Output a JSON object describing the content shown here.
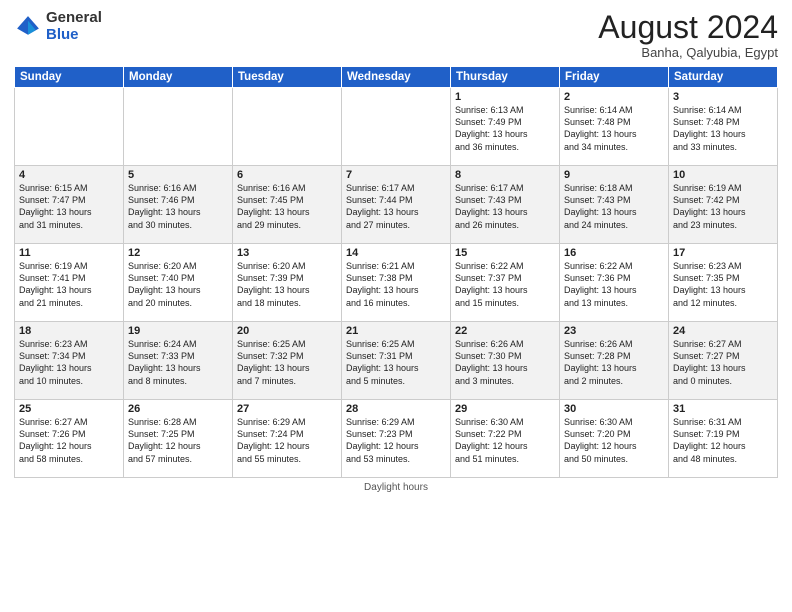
{
  "header": {
    "logo_general": "General",
    "logo_blue": "Blue",
    "month_year": "August 2024",
    "location": "Banha, Qalyubia, Egypt"
  },
  "days_of_week": [
    "Sunday",
    "Monday",
    "Tuesday",
    "Wednesday",
    "Thursday",
    "Friday",
    "Saturday"
  ],
  "weeks": [
    [
      {
        "day": "",
        "info": ""
      },
      {
        "day": "",
        "info": ""
      },
      {
        "day": "",
        "info": ""
      },
      {
        "day": "",
        "info": ""
      },
      {
        "day": "1",
        "info": "Sunrise: 6:13 AM\nSunset: 7:49 PM\nDaylight: 13 hours\nand 36 minutes."
      },
      {
        "day": "2",
        "info": "Sunrise: 6:14 AM\nSunset: 7:48 PM\nDaylight: 13 hours\nand 34 minutes."
      },
      {
        "day": "3",
        "info": "Sunrise: 6:14 AM\nSunset: 7:48 PM\nDaylight: 13 hours\nand 33 minutes."
      }
    ],
    [
      {
        "day": "4",
        "info": "Sunrise: 6:15 AM\nSunset: 7:47 PM\nDaylight: 13 hours\nand 31 minutes."
      },
      {
        "day": "5",
        "info": "Sunrise: 6:16 AM\nSunset: 7:46 PM\nDaylight: 13 hours\nand 30 minutes."
      },
      {
        "day": "6",
        "info": "Sunrise: 6:16 AM\nSunset: 7:45 PM\nDaylight: 13 hours\nand 29 minutes."
      },
      {
        "day": "7",
        "info": "Sunrise: 6:17 AM\nSunset: 7:44 PM\nDaylight: 13 hours\nand 27 minutes."
      },
      {
        "day": "8",
        "info": "Sunrise: 6:17 AM\nSunset: 7:43 PM\nDaylight: 13 hours\nand 26 minutes."
      },
      {
        "day": "9",
        "info": "Sunrise: 6:18 AM\nSunset: 7:43 PM\nDaylight: 13 hours\nand 24 minutes."
      },
      {
        "day": "10",
        "info": "Sunrise: 6:19 AM\nSunset: 7:42 PM\nDaylight: 13 hours\nand 23 minutes."
      }
    ],
    [
      {
        "day": "11",
        "info": "Sunrise: 6:19 AM\nSunset: 7:41 PM\nDaylight: 13 hours\nand 21 minutes."
      },
      {
        "day": "12",
        "info": "Sunrise: 6:20 AM\nSunset: 7:40 PM\nDaylight: 13 hours\nand 20 minutes."
      },
      {
        "day": "13",
        "info": "Sunrise: 6:20 AM\nSunset: 7:39 PM\nDaylight: 13 hours\nand 18 minutes."
      },
      {
        "day": "14",
        "info": "Sunrise: 6:21 AM\nSunset: 7:38 PM\nDaylight: 13 hours\nand 16 minutes."
      },
      {
        "day": "15",
        "info": "Sunrise: 6:22 AM\nSunset: 7:37 PM\nDaylight: 13 hours\nand 15 minutes."
      },
      {
        "day": "16",
        "info": "Sunrise: 6:22 AM\nSunset: 7:36 PM\nDaylight: 13 hours\nand 13 minutes."
      },
      {
        "day": "17",
        "info": "Sunrise: 6:23 AM\nSunset: 7:35 PM\nDaylight: 13 hours\nand 12 minutes."
      }
    ],
    [
      {
        "day": "18",
        "info": "Sunrise: 6:23 AM\nSunset: 7:34 PM\nDaylight: 13 hours\nand 10 minutes."
      },
      {
        "day": "19",
        "info": "Sunrise: 6:24 AM\nSunset: 7:33 PM\nDaylight: 13 hours\nand 8 minutes."
      },
      {
        "day": "20",
        "info": "Sunrise: 6:25 AM\nSunset: 7:32 PM\nDaylight: 13 hours\nand 7 minutes."
      },
      {
        "day": "21",
        "info": "Sunrise: 6:25 AM\nSunset: 7:31 PM\nDaylight: 13 hours\nand 5 minutes."
      },
      {
        "day": "22",
        "info": "Sunrise: 6:26 AM\nSunset: 7:30 PM\nDaylight: 13 hours\nand 3 minutes."
      },
      {
        "day": "23",
        "info": "Sunrise: 6:26 AM\nSunset: 7:28 PM\nDaylight: 13 hours\nand 2 minutes."
      },
      {
        "day": "24",
        "info": "Sunrise: 6:27 AM\nSunset: 7:27 PM\nDaylight: 13 hours\nand 0 minutes."
      }
    ],
    [
      {
        "day": "25",
        "info": "Sunrise: 6:27 AM\nSunset: 7:26 PM\nDaylight: 12 hours\nand 58 minutes."
      },
      {
        "day": "26",
        "info": "Sunrise: 6:28 AM\nSunset: 7:25 PM\nDaylight: 12 hours\nand 57 minutes."
      },
      {
        "day": "27",
        "info": "Sunrise: 6:29 AM\nSunset: 7:24 PM\nDaylight: 12 hours\nand 55 minutes."
      },
      {
        "day": "28",
        "info": "Sunrise: 6:29 AM\nSunset: 7:23 PM\nDaylight: 12 hours\nand 53 minutes."
      },
      {
        "day": "29",
        "info": "Sunrise: 6:30 AM\nSunset: 7:22 PM\nDaylight: 12 hours\nand 51 minutes."
      },
      {
        "day": "30",
        "info": "Sunrise: 6:30 AM\nSunset: 7:20 PM\nDaylight: 12 hours\nand 50 minutes."
      },
      {
        "day": "31",
        "info": "Sunrise: 6:31 AM\nSunset: 7:19 PM\nDaylight: 12 hours\nand 48 minutes."
      }
    ]
  ],
  "footer": {
    "daylight_hours": "Daylight hours"
  }
}
